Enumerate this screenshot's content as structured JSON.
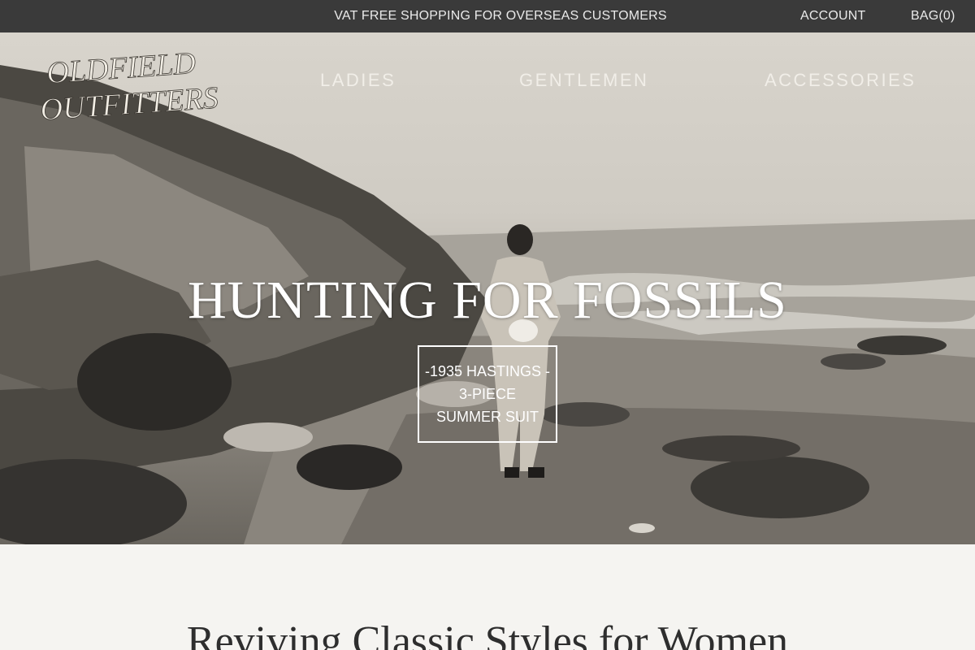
{
  "topbar": {
    "announcement": "VAT FREE SHOPPING FOR OVERSEAS CUSTOMERS",
    "account": "ACCOUNT",
    "bag": "BAG(0)"
  },
  "header": {
    "logo_text": "OLDFIELD OUTFITTERS",
    "nav": [
      "LADIES",
      "GENTLEMEN",
      "ACCESSORIES"
    ]
  },
  "hero": {
    "title": "HUNTING FOR FOSSILS",
    "box_lines": [
      "-1935 HASTINGS -",
      "3-PIECE",
      "SUMMER SUIT"
    ]
  },
  "section": {
    "title": "Reviving Classic Styles for Women"
  },
  "colors": {
    "topbar_bg": "#3a3a3a",
    "page_bg": "#f5f4f1",
    "hero_text": "#ffffff"
  }
}
